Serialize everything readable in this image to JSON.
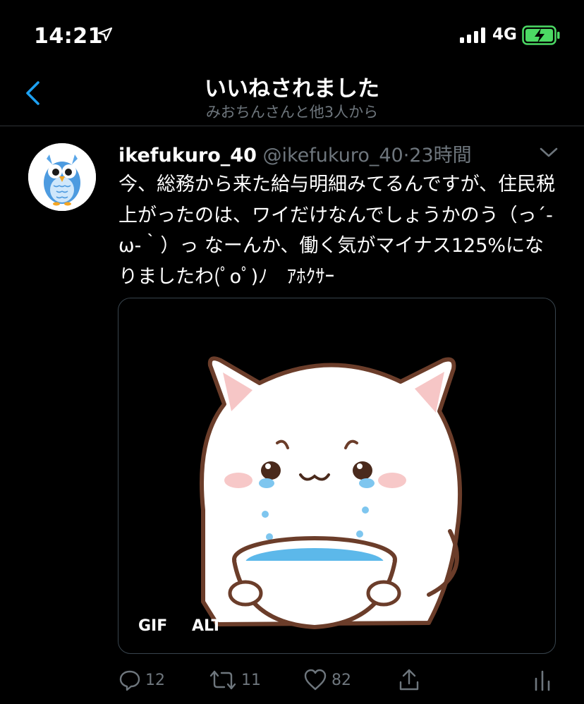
{
  "status_bar": {
    "time": "14:21",
    "network": "4G"
  },
  "nav": {
    "title": "いいねされました",
    "subtitle": "みおちんさんと他3人から"
  },
  "tweet": {
    "name": "ikefukuro_40",
    "handle": "@ikefukuro_40",
    "separator": "·",
    "time": "23時間",
    "text": "今、総務から来た給与明細みてるんですが、住民税上がったのは、ワイだけなんでしょうかのう（っ´-ω-｀）っ なーんか、働く気がマイナス125%になりましたわ(ﾟoﾟ)ﾉ　ｱﾎｸｻｰ",
    "media": {
      "badge_gif": "GIF",
      "badge_alt": "ALT"
    },
    "actions": {
      "replies": "12",
      "retweets": "11",
      "likes": "82"
    }
  },
  "icons": {
    "back": "chevron-left-icon",
    "location": "location-arrow-icon",
    "more": "chevron-down-icon",
    "reply": "comment-icon",
    "retweet": "retweet-icon",
    "like": "heart-icon",
    "share": "share-icon",
    "analytics": "analytics-icon"
  },
  "colors": {
    "accent": "#1da1f2",
    "muted": "#6e767d",
    "battery": "#4cd964",
    "background": "#000000"
  }
}
